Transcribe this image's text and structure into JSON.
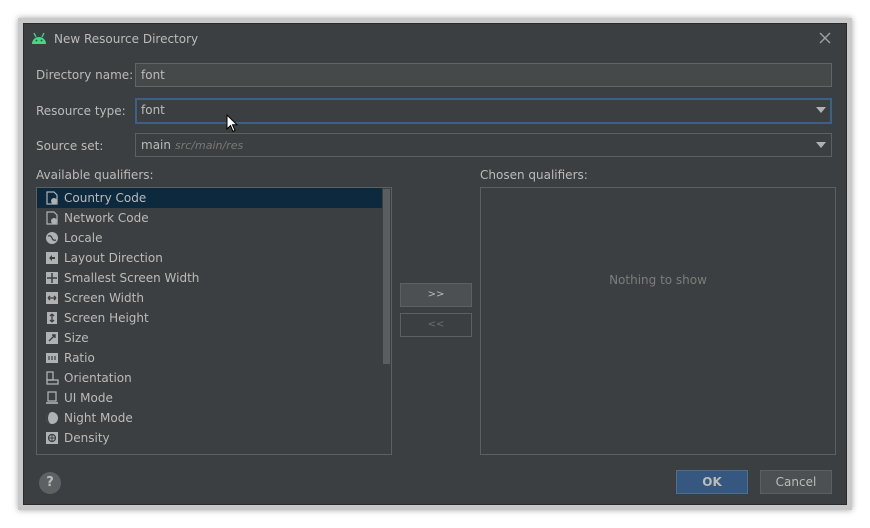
{
  "window": {
    "title": "New Resource Directory",
    "icon": "android-icon",
    "accent": "#3ddc84"
  },
  "form": {
    "directory_name_label": "Directory name:",
    "directory_name_value": "font",
    "resource_type_label": "Resource type:",
    "resource_type_value": "font",
    "source_set_label": "Source set:",
    "source_set_value": "main",
    "source_set_path": "src/main/res"
  },
  "qualifiers": {
    "available_label": "Available qualifiers:",
    "chosen_label": "Chosen qualifiers:",
    "chosen_empty_text": "Nothing to show",
    "items": [
      {
        "label": "Country Code",
        "icon": "sim-card-icon",
        "selected": true
      },
      {
        "label": "Network Code",
        "icon": "sim-card-icon",
        "selected": false
      },
      {
        "label": "Locale",
        "icon": "globe-icon",
        "selected": false
      },
      {
        "label": "Layout Direction",
        "icon": "layout-direction-icon",
        "selected": false
      },
      {
        "label": "Smallest Screen Width",
        "icon": "smallest-width-icon",
        "selected": false
      },
      {
        "label": "Screen Width",
        "icon": "screen-width-icon",
        "selected": false
      },
      {
        "label": "Screen Height",
        "icon": "screen-height-icon",
        "selected": false
      },
      {
        "label": "Size",
        "icon": "size-icon",
        "selected": false
      },
      {
        "label": "Ratio",
        "icon": "ratio-icon",
        "selected": false
      },
      {
        "label": "Orientation",
        "icon": "orientation-icon",
        "selected": false
      },
      {
        "label": "UI Mode",
        "icon": "ui-mode-icon",
        "selected": false
      },
      {
        "label": "Night Mode",
        "icon": "night-mode-icon",
        "selected": false
      },
      {
        "label": "Density",
        "icon": "density-icon",
        "selected": false
      }
    ],
    "add_button": ">>",
    "remove_button": "<<"
  },
  "footer": {
    "help_label": "?",
    "ok_label": "OK",
    "cancel_label": "Cancel"
  }
}
